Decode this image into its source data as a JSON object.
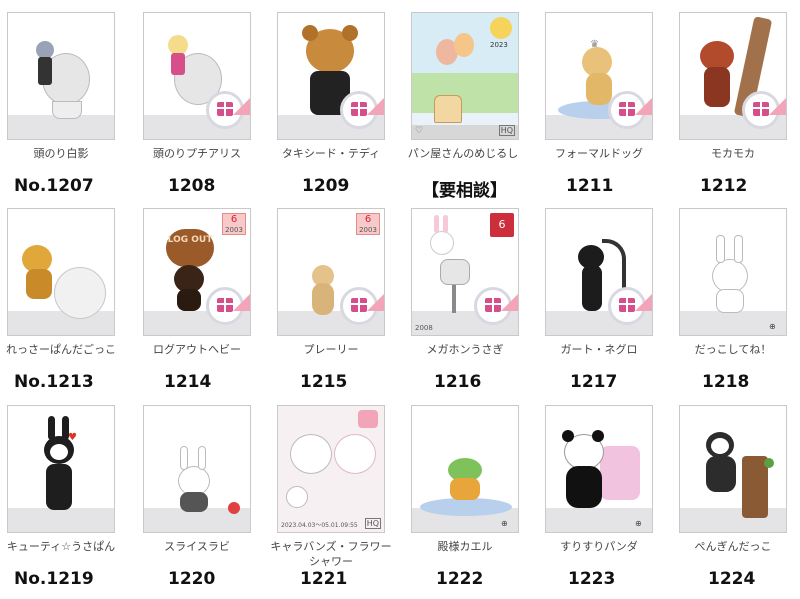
{
  "items": [
    {
      "name": "頭のり白影",
      "number": "No.1207",
      "overlay": "gift"
    },
    {
      "name": "頭のりプチアリス",
      "number": "1208",
      "overlay": "gift"
    },
    {
      "name": "タキシード・テディ",
      "number": "1209",
      "overlay": "gift"
    },
    {
      "name": "パン屋さんのめじるし",
      "number": "【要相談】",
      "overlay": "hq",
      "label_2023": "2023"
    },
    {
      "name": "フォーマルドッグ",
      "number": "1211",
      "overlay": "gift"
    },
    {
      "name": "モカモカ",
      "number": "1212",
      "overlay": "gift"
    },
    {
      "name": "れっさーぱんだごっこ",
      "number": "No.1213",
      "overlay": "none"
    },
    {
      "name": "ログアウトヘビー",
      "number": "1214",
      "overlay": "gift",
      "tag6": "6",
      "tag6_year": "2003",
      "sign_text": "LOG OUT"
    },
    {
      "name": "プレーリー",
      "number": "1215",
      "overlay": "gift",
      "tag6": "6",
      "tag6_year": "2003"
    },
    {
      "name": "メガホンうさぎ",
      "number": "1216",
      "overlay": "gift",
      "badge": "6",
      "stamp": "2008"
    },
    {
      "name": "ガート・ネグロ",
      "number": "1217",
      "overlay": "gift"
    },
    {
      "name": "だっこしてね！",
      "number": "1218",
      "overlay": "zoom"
    },
    {
      "name": "キューティ☆うさぱん",
      "number": "No.1219",
      "overlay": "none"
    },
    {
      "name": "スライスラビ",
      "number": "1220",
      "overlay": "none"
    },
    {
      "name": "キャラバンズ・フラワーシャワー",
      "number": "1221",
      "overlay": "hq",
      "stamp": "2023.04.03～05.01.09:55"
    },
    {
      "name": "殿様カエル",
      "number": "1222",
      "overlay": "none"
    },
    {
      "name": "すりすりパンダ",
      "number": "1223",
      "overlay": "zoom"
    },
    {
      "name": "ぺんぎんだっこ",
      "number": "1224",
      "overlay": "none"
    }
  ],
  "colors": {
    "gift": "#d64f8a",
    "corner": "#f2a5b8",
    "floor": "#e4e4e6"
  }
}
